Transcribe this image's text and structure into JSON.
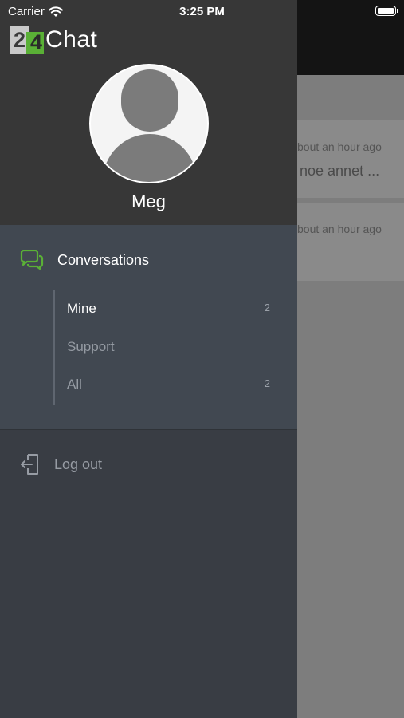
{
  "status_bar": {
    "carrier": "Carrier",
    "time": "3:25 PM"
  },
  "app": {
    "logo_digit_1": "2",
    "logo_digit_2": "4",
    "logo_text": "Chat"
  },
  "user": {
    "name": "Meg"
  },
  "menu": {
    "conversations_label": "Conversations",
    "sub_items": [
      {
        "label": "Mine",
        "count": "2"
      },
      {
        "label": "Support",
        "count": ""
      },
      {
        "label": "All",
        "count": "2"
      }
    ],
    "logout_label": "Log out"
  },
  "background_list": {
    "items": [
      {
        "time": "bout an hour ago",
        "preview": "noe annet ..."
      },
      {
        "time": "bout an hour ago",
        "preview": ""
      }
    ]
  },
  "colors": {
    "accent": "#5ab036",
    "drawer_header": "#373737",
    "drawer_menu": "#414851",
    "drawer_body": "#393d44"
  }
}
